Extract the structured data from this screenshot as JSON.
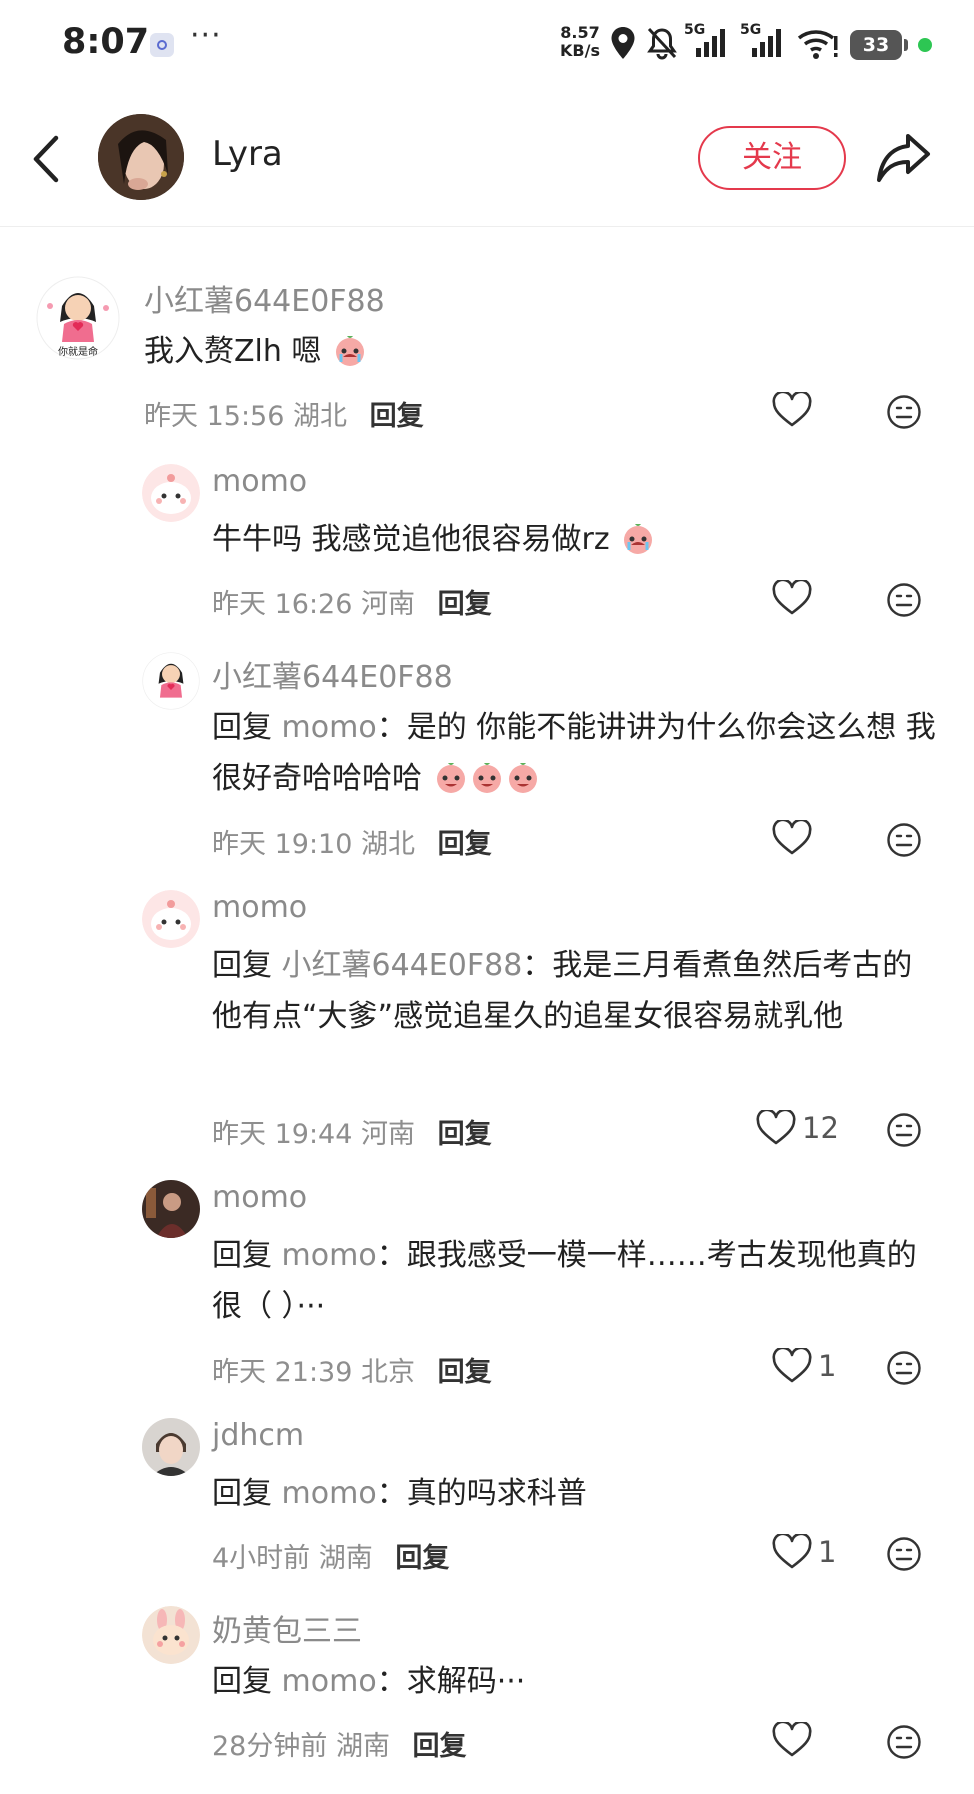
{
  "status_bar": {
    "time": "8:07",
    "more": "···",
    "net_speed_value": "8.57",
    "net_speed_unit": "KB/s",
    "signal_1": "5G",
    "signal_2": "5G",
    "battery": "33",
    "icons": [
      "app-notification-icon",
      "location-icon",
      "bell-muted-icon",
      "signal-icon",
      "signal-icon",
      "wifi-icon",
      "battery-icon"
    ]
  },
  "header": {
    "username": "Lyra",
    "follow_label": "关注",
    "icons": [
      "back-arrow-icon",
      "share-icon"
    ]
  },
  "comments": [
    {
      "author": "小红薯644E0F88",
      "text": "我入赘Zlh 嗯",
      "emoji_count": 1,
      "time": "昨天 15:56",
      "location": "湖北",
      "reply_label": "回复",
      "likes": ""
    },
    {
      "author": "momo",
      "text": "牛牛吗 我感觉追他很容易做rz",
      "emoji_count": 1,
      "time": "昨天 16:26",
      "location": "河南",
      "reply_label": "回复",
      "likes": ""
    },
    {
      "author": "小红薯644E0F88",
      "reply_prefix": "回复",
      "reply_target": "momo",
      "text": "：是的 你能不能讲讲为什么你会这么想 我很好奇哈哈哈哈",
      "emoji_count": 3,
      "time": "昨天 19:10",
      "location": "湖北",
      "reply_label": "回复",
      "likes": ""
    },
    {
      "author": "momo",
      "reply_prefix": "回复",
      "reply_target": "小红薯644E0F88",
      "text": "：我是三月看煮鱼然后考古的 他有点“大爹”感觉追星久的追星女很容易就乳他",
      "time": "昨天 19:44",
      "location": "河南",
      "reply_label": "回复",
      "likes": "12"
    },
    {
      "author": "momo",
      "reply_prefix": "回复",
      "reply_target": "momo",
      "text": "：跟我感受一模一样……考古发现他真的很（ ）···",
      "time": "昨天 21:39",
      "location": "北京",
      "reply_label": "回复",
      "likes": "1"
    },
    {
      "author": "jdhcm",
      "reply_prefix": "回复",
      "reply_target": "momo",
      "text": "：真的吗求科普",
      "time": "4小时前",
      "location": "湖南",
      "reply_label": "回复",
      "likes": "1"
    },
    {
      "author": "奶黄包三三",
      "reply_prefix": "回复",
      "reply_target": "momo",
      "text": "：求解码···",
      "time": "28分钟前",
      "location": "湖南",
      "reply_label": "回复",
      "likes": ""
    }
  ],
  "colors": {
    "accent": "#e4394c",
    "muted_text": "#8a8a8a",
    "online_dot": "#2dc653"
  }
}
